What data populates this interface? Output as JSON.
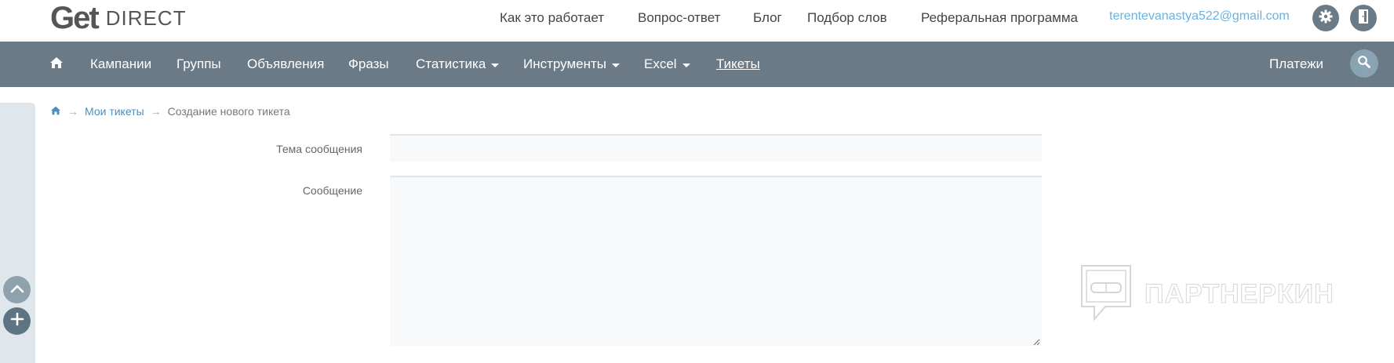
{
  "logo": {
    "get": "Get",
    "direct": "DIRECT"
  },
  "top_links": [
    {
      "label": "Как это работает"
    },
    {
      "label": "Вопрос-ответ"
    },
    {
      "label": "Блог"
    },
    {
      "label": "Подбор слов"
    },
    {
      "label": "Реферальная программа"
    }
  ],
  "user_email": "terentevanastya522@gmail.com",
  "header_icons": {
    "settings": "gear-icon",
    "logout": "door-exit-icon"
  },
  "nav": {
    "home_icon": "home-icon",
    "items": [
      {
        "label": "Кампании"
      },
      {
        "label": "Группы"
      },
      {
        "label": "Объявления"
      },
      {
        "label": "Фразы"
      },
      {
        "label": "Статистика"
      },
      {
        "label": "Инструменты"
      },
      {
        "label": "Excel"
      },
      {
        "label": "Тикеты"
      }
    ],
    "payments": "Платежи",
    "search_icon": "search-icon"
  },
  "breadcrumb": {
    "home_icon": "home-icon",
    "separator": "→",
    "link": "Мои тикеты",
    "current": "Создание нового тикета"
  },
  "form": {
    "subject_label": "Тема сообщения",
    "subject_value": "",
    "message_label": "Сообщение",
    "message_value": ""
  },
  "rail": {
    "up_icon": "chevron-up-icon",
    "add_icon": "plus-icon"
  },
  "watermark": {
    "text": "ПАРТНЕРКИН"
  },
  "colors": {
    "nav_bg": "#6a7b87",
    "link": "#4a8fc1",
    "email": "#6ab2df",
    "rail_bg": "#dfe7ec",
    "input_bg": "#f8f9fa"
  }
}
